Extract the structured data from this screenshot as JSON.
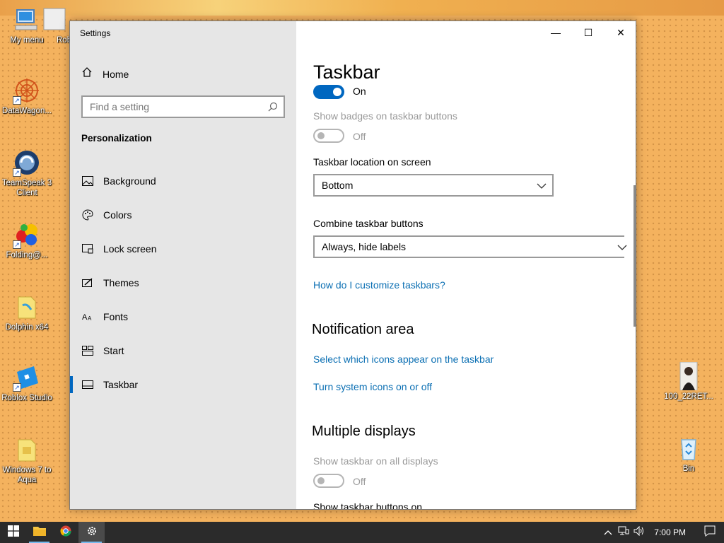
{
  "desktop": {
    "icons": [
      {
        "label": "My menu"
      },
      {
        "label": "Rob"
      },
      {
        "label": "DataWagon..."
      },
      {
        "label": "TeamSpeak 3 Client"
      },
      {
        "label": "Folding@..."
      },
      {
        "label": "Dolphin x64"
      },
      {
        "label": "Roblox Studio"
      },
      {
        "label": "Windows 7 to Aqua"
      },
      {
        "label": "100_22RET..."
      },
      {
        "label": "Bin"
      }
    ]
  },
  "window": {
    "title": "Settings",
    "controls": {
      "minimize": "—",
      "maximize": "☐",
      "close": "✕"
    }
  },
  "sidebar": {
    "home_label": "Home",
    "search_placeholder": "Find a setting",
    "section": "Personalization",
    "items": [
      {
        "label": "Background",
        "icon": "picture-icon"
      },
      {
        "label": "Colors",
        "icon": "palette-icon"
      },
      {
        "label": "Lock screen",
        "icon": "lock-screen-icon"
      },
      {
        "label": "Themes",
        "icon": "themes-icon"
      },
      {
        "label": "Fonts",
        "icon": "fonts-icon"
      },
      {
        "label": "Start",
        "icon": "start-icon"
      },
      {
        "label": "Taskbar",
        "icon": "taskbar-icon",
        "active": true
      }
    ]
  },
  "content": {
    "title": "Taskbar",
    "toggle_top_state": "On",
    "badges_label": "Show badges on taskbar buttons",
    "badges_state": "Off",
    "location_label": "Taskbar location on screen",
    "location_value": "Bottom",
    "combine_label": "Combine taskbar buttons",
    "combine_value": "Always, hide labels",
    "customize_link": "How do I customize taskbars?",
    "notification_heading": "Notification area",
    "notification_link1": "Select which icons appear on the taskbar",
    "notification_link2": "Turn system icons on or off",
    "multiple_heading": "Multiple displays",
    "all_displays_label": "Show taskbar on all displays",
    "all_displays_state": "Off",
    "buttons_on_label": "Show taskbar buttons on"
  },
  "taskbar": {
    "clock": "7:00 PM"
  },
  "colors": {
    "accent": "#0067c0",
    "link": "#0b6fb3",
    "sidebar_bg": "#e6e6e6",
    "taskbar_bg": "#2b2b2b"
  }
}
